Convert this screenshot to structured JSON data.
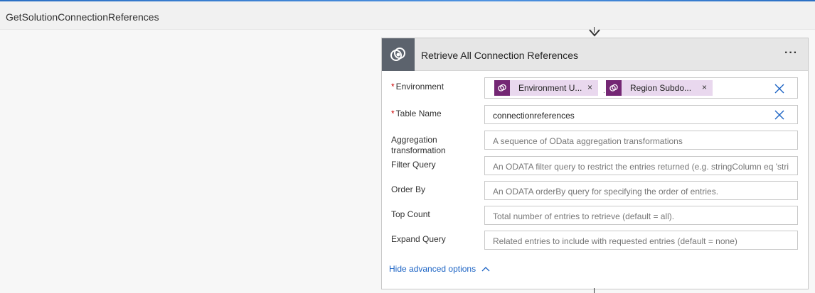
{
  "page": {
    "title": "GetSolutionConnectionReferences"
  },
  "action": {
    "title": "Retrieve All Connection References",
    "more_label": "···",
    "fields": {
      "environment": {
        "label": "Environment",
        "required_mark": "*",
        "tokens": [
          {
            "label": "Environment U...",
            "icon": "dataverse-token-icon"
          },
          {
            "label": "Region Subdo...",
            "icon": "dataverse-token-icon"
          }
        ],
        "token_separator": "."
      },
      "table_name": {
        "label": "Table Name",
        "required_mark": "*",
        "value": "connectionreferences"
      },
      "aggregation": {
        "label_line1": "Aggregation",
        "label_line2": "transformation",
        "placeholder": "A sequence of OData aggregation transformations"
      },
      "filter_query": {
        "label": "Filter Query",
        "placeholder": "An ODATA filter query to restrict the entries returned (e.g. stringColumn eq 'stri"
      },
      "order_by": {
        "label": "Order By",
        "placeholder": "An ODATA orderBy query for specifying the order of entries."
      },
      "top_count": {
        "label": "Top Count",
        "placeholder": "Total number of entries to retrieve (default = all)."
      },
      "expand_query": {
        "label": "Expand Query",
        "placeholder": "Related entries to include with requested entries (default = none)"
      }
    },
    "advanced_toggle_label": "Hide advanced options"
  },
  "colors": {
    "accent": "#2a6fc4",
    "header_icon_bg": "#5c636d",
    "token_bg": "#e9d8ee",
    "token_icon_bg": "#742774",
    "link": "#1b63c4",
    "required": "#cc0000"
  },
  "icons": {
    "connector_arrow": "arrow-down-icon",
    "card": "dataverse-icon",
    "clear": "clear-x-icon",
    "advanced": "chevron-up-icon"
  }
}
